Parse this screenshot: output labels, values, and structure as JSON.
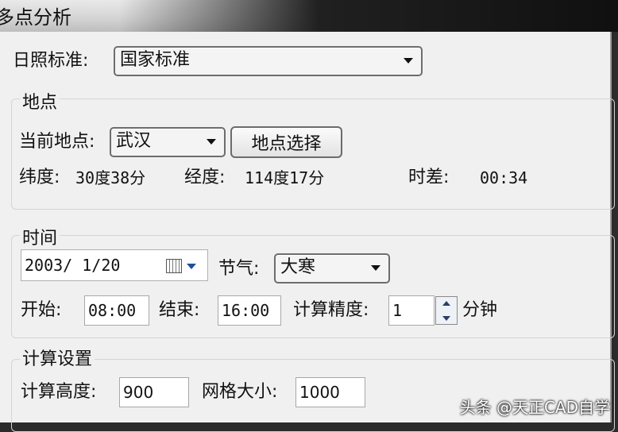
{
  "window": {
    "title": "多点分析"
  },
  "sunlight": {
    "label": "日照标准:",
    "value": "国家标准"
  },
  "location": {
    "group_title": "地点",
    "current_label": "当前地点:",
    "current_value": "武汉",
    "select_button": "地点选择",
    "lat_label": "纬度:",
    "lat_value": "30度38分",
    "lon_label": "经度:",
    "lon_value": "114度17分",
    "tz_label": "时差:",
    "tz_value": "00:34"
  },
  "time": {
    "group_title": "时间",
    "date_value": "2003/ 1/20",
    "solar_term_label": "节气:",
    "solar_term_value": "大寒",
    "start_label": "开始:",
    "start_value": "08:00",
    "end_label": "结束:",
    "end_value": "16:00",
    "precision_label": "计算精度:",
    "precision_value": "1",
    "precision_unit": "分钟"
  },
  "calc": {
    "group_title": "计算设置",
    "height_label": "计算高度:",
    "height_value": "900",
    "grid_label": "网格大小:",
    "grid_value": "1000"
  },
  "watermark": "头条 @天正CAD自学"
}
